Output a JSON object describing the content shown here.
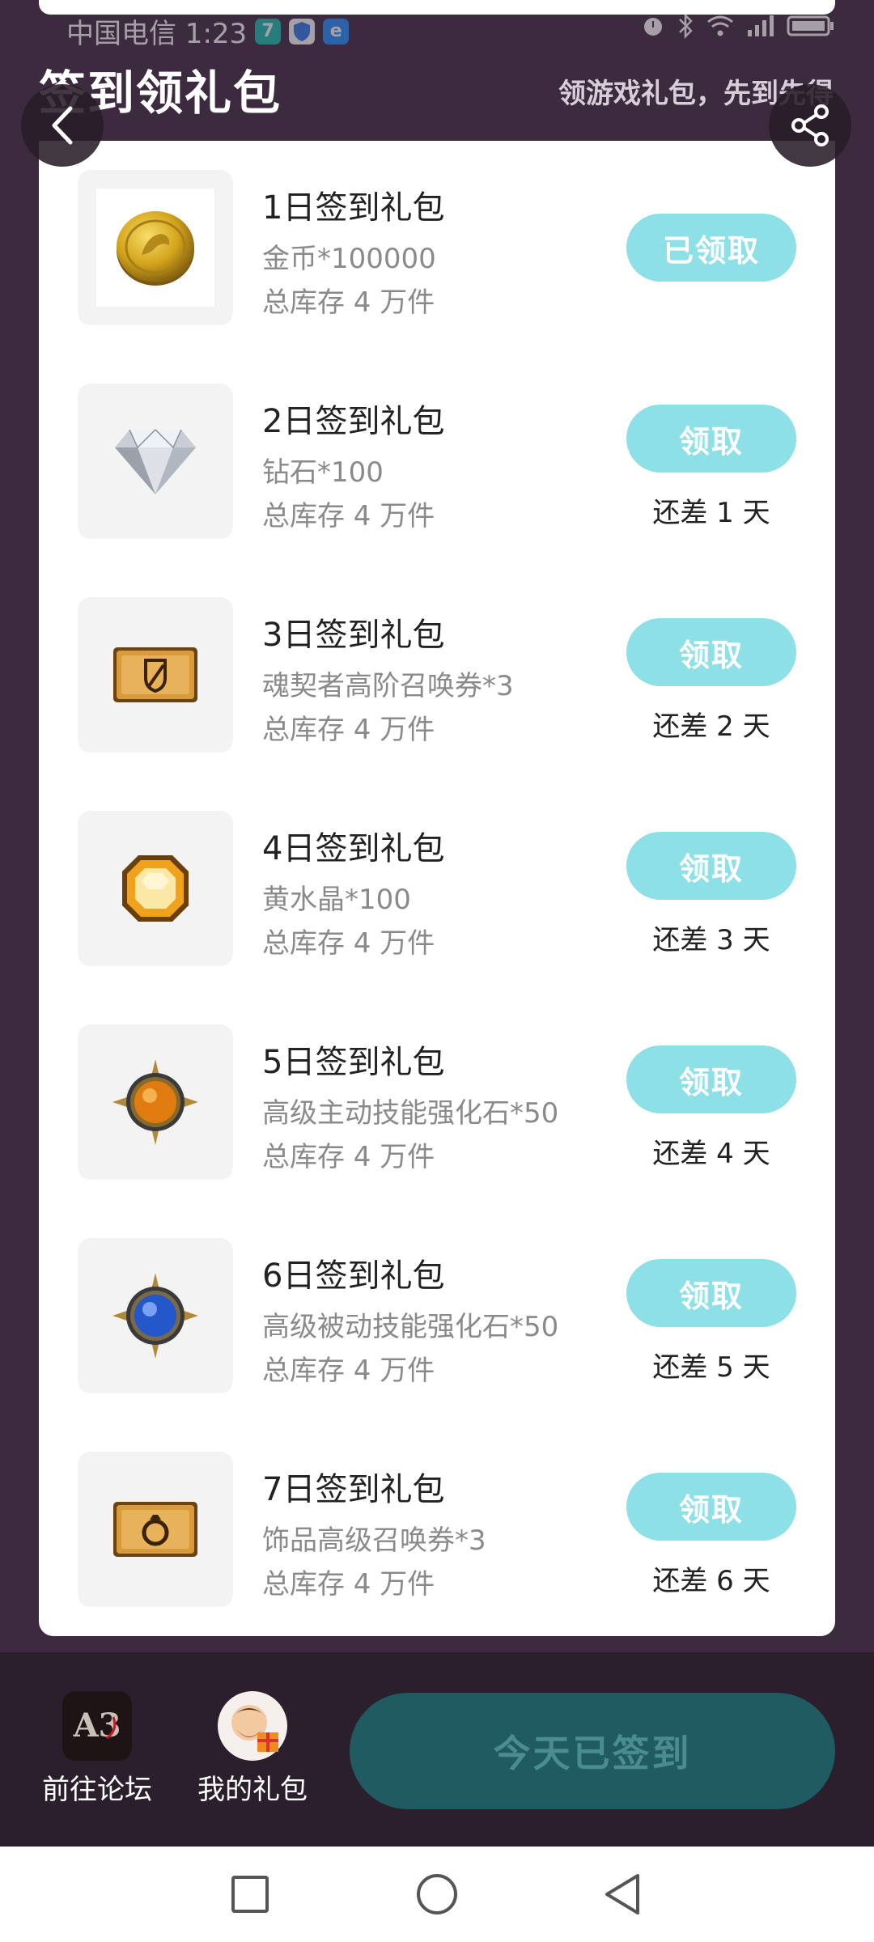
{
  "status_bar": {
    "carrier_time": "中国电信 1:23",
    "app_icons": [
      {
        "icon": "seven-app-icon",
        "glyph": "7",
        "color": "#19c2b0"
      },
      {
        "icon": "shield-app-icon",
        "glyph": "",
        "color": "#2b7de9"
      },
      {
        "icon": "e-app-icon",
        "glyph": "e",
        "color": "#1e90ff"
      }
    ],
    "indicators": [
      "alarm-icon",
      "bluetooth-icon",
      "wifi-icon",
      "signal-icon",
      "battery-icon"
    ]
  },
  "header": {
    "title": "签到领礼包",
    "subtitle": "领游戏礼包，先到先得"
  },
  "gifts": [
    {
      "title": "1日签到礼包",
      "desc": "金币*100000",
      "stock": "总库存 4 万件",
      "button": "已领取",
      "remain": "",
      "icon": "gold-coin-icon"
    },
    {
      "title": "2日签到礼包",
      "desc": "钻石*100",
      "stock": "总库存 4 万件",
      "button": "领取",
      "remain": "还差 1 天",
      "icon": "diamond-icon"
    },
    {
      "title": "3日签到礼包",
      "desc": "魂契者高阶召唤券*3",
      "stock": "总库存 4 万件",
      "button": "领取",
      "remain": "还差 2 天",
      "icon": "summon-ticket-icon"
    },
    {
      "title": "4日签到礼包",
      "desc": "黄水晶*100",
      "stock": "总库存 4 万件",
      "button": "领取",
      "remain": "还差 3 天",
      "icon": "yellow-crystal-icon"
    },
    {
      "title": "5日签到礼包",
      "desc": "高级主动技能强化石*50",
      "stock": "总库存 4 万件",
      "button": "领取",
      "remain": "还差 4 天",
      "icon": "orange-skill-stone-icon"
    },
    {
      "title": "6日签到礼包",
      "desc": "高级被动技能强化石*50",
      "stock": "总库存 4 万件",
      "button": "领取",
      "remain": "还差 5 天",
      "icon": "blue-skill-stone-icon"
    },
    {
      "title": "7日签到礼包",
      "desc": "饰品高级召唤券*3",
      "stock": "总库存 4 万件",
      "button": "领取",
      "remain": "还差 6 天",
      "icon": "ring-ticket-icon"
    }
  ],
  "bottom_bar": {
    "forum_label": "前往论坛",
    "forum_logo_text": "A3",
    "my_gifts_label": "我的礼包",
    "signed_button": "今天已签到"
  },
  "colors": {
    "background": "#3c2a3e",
    "claim_button": "#8de0e6",
    "signed_button": "#1f5b60",
    "bottom_bar": "#2c1f2d"
  }
}
